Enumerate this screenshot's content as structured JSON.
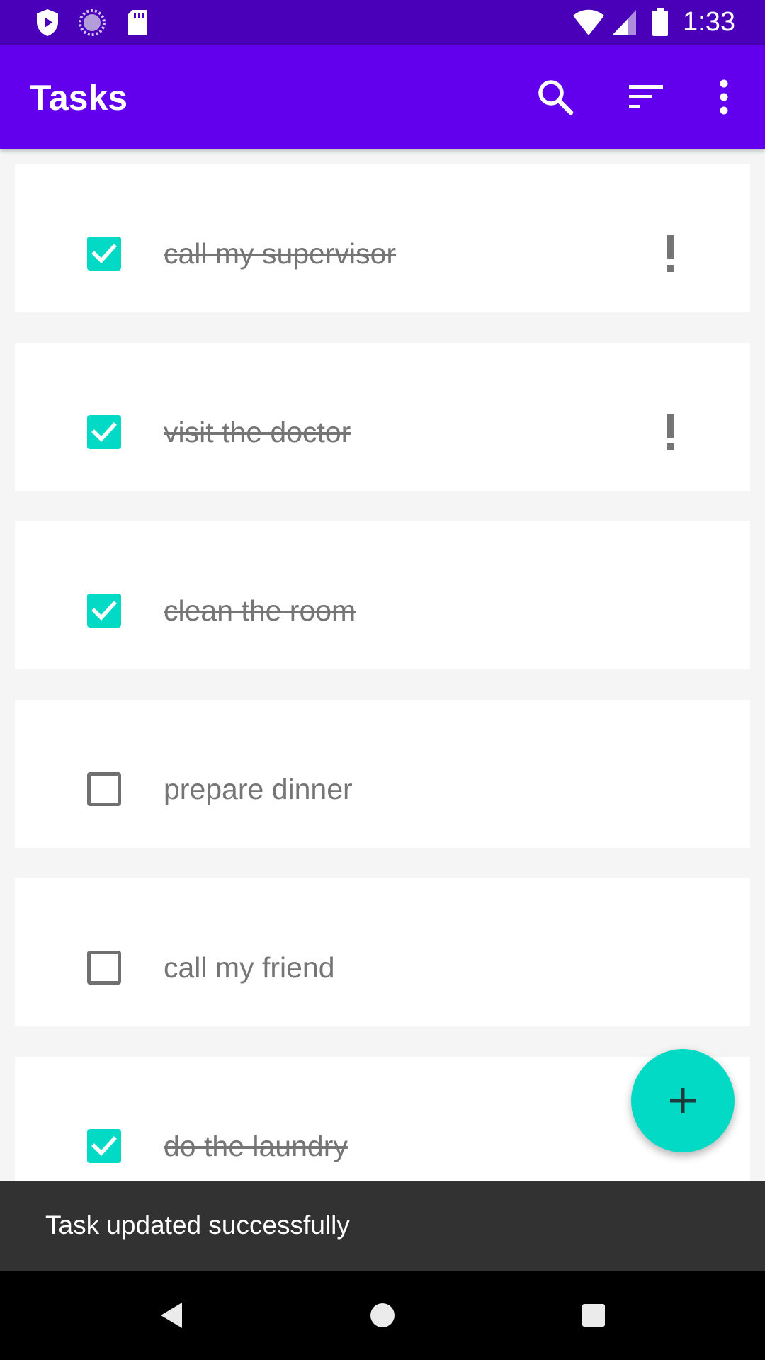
{
  "status_bar": {
    "time": "1:33",
    "icons": [
      "play-protect-icon",
      "sync-icon",
      "sd-card-icon",
      "wifi-icon",
      "signal-icon",
      "battery-icon"
    ]
  },
  "app_bar": {
    "title": "Tasks",
    "actions": [
      "search-icon",
      "sort-icon",
      "more-vert-icon"
    ],
    "color": "#6200ee"
  },
  "tasks": [
    {
      "label": "call my supervisor",
      "completed": true,
      "important": true
    },
    {
      "label": "visit the doctor",
      "completed": true,
      "important": true
    },
    {
      "label": "clean the room",
      "completed": true,
      "important": false
    },
    {
      "label": "prepare dinner",
      "completed": false,
      "important": false
    },
    {
      "label": "call my friend",
      "completed": false,
      "important": false
    },
    {
      "label": "do the laundry",
      "completed": true,
      "important": false
    }
  ],
  "fab": {
    "icon": "add-icon",
    "color": "#03dac5"
  },
  "snackbar": {
    "message": "Task updated successfully"
  },
  "nav_bar": {
    "buttons": [
      "back-icon",
      "home-icon",
      "recents-icon"
    ]
  }
}
